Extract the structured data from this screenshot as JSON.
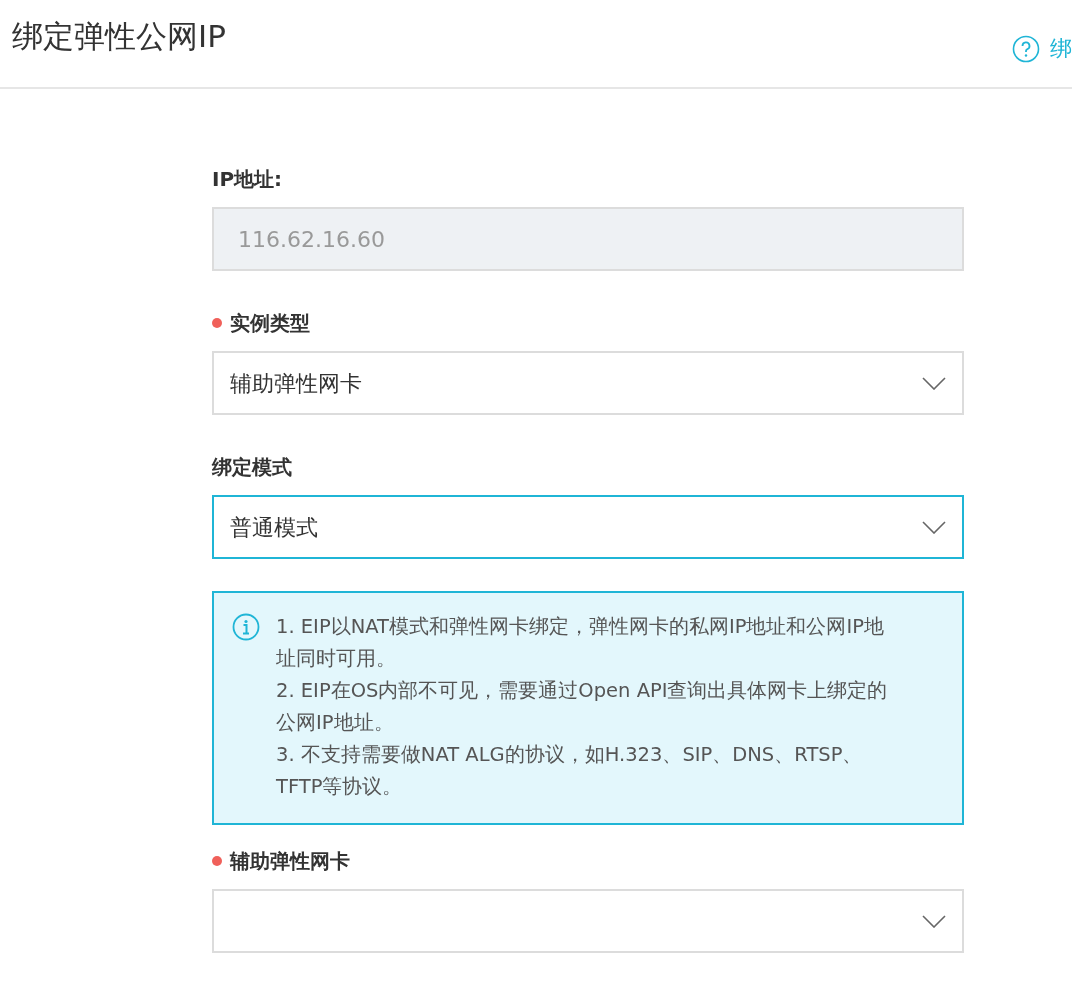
{
  "header": {
    "title": "绑定弹性公网IP",
    "help_link": "绑"
  },
  "fields": [
    {
      "kind": "text",
      "label": "IP地址:",
      "required": false,
      "value": "116.62.16.60",
      "disabled": true,
      "focused": false
    },
    {
      "kind": "select",
      "label": "实例类型",
      "required": true,
      "value": "辅助弹性网卡",
      "disabled": false,
      "focused": false
    },
    {
      "kind": "select",
      "label": "绑定模式",
      "required": false,
      "value": "普通模式",
      "disabled": false,
      "focused": true,
      "notice": [
        "1. EIP以NAT模式和弹性网卡绑定，弹性网卡的私网IP地址和公网IP地址同时可用。",
        "2. EIP在OS内部不可见，需要通过Open API查询出具体网卡上绑定的公网IP地址。",
        "3. 不支持需要做NAT ALG的协议，如H.323、SIP、DNS、RTSP、TFTP等协议。"
      ]
    },
    {
      "kind": "select",
      "label": "辅助弹性网卡",
      "required": true,
      "disabled": false,
      "focused": false
    }
  ]
}
